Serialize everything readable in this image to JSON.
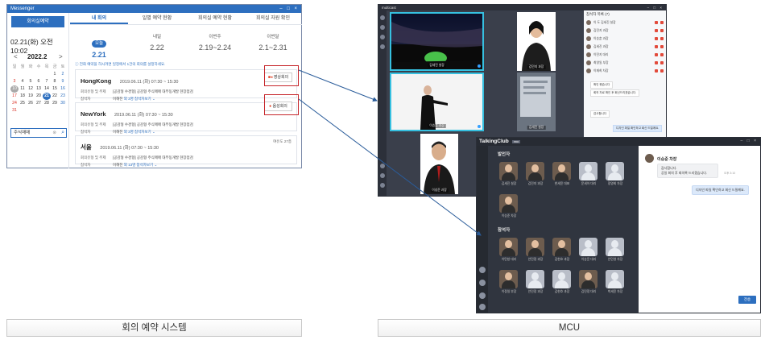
{
  "messenger": {
    "title": "Messenger",
    "reserve_button": "회의실예약",
    "today": "02.21(화) 오전 10:02",
    "calendar": {
      "year_month": "2022.2",
      "prev": "<",
      "next": ">",
      "weekdays": [
        "일",
        "월",
        "화",
        "수",
        "목",
        "금",
        "토"
      ],
      "days": [
        "",
        "",
        "",
        "",
        "",
        "1",
        "2",
        "3",
        "4",
        "5",
        "6",
        "7",
        "8",
        "9",
        "10",
        "11",
        "12",
        "13",
        "14",
        "15",
        "16",
        "17",
        "18",
        "19",
        "20",
        "21",
        "22",
        "23",
        "24",
        "25",
        "26",
        "27",
        "28",
        "29",
        "30",
        "31"
      ]
    },
    "search_value": "주식매매",
    "tabs": [
      "내 회의",
      "일별 예약 현황",
      "회의실 예약 현황",
      "회의실 자원 확인"
    ],
    "periods": [
      {
        "label": "오늘",
        "range": "2.21"
      },
      {
        "label": "내일",
        "range": "2.22"
      },
      {
        "label": "이번주",
        "range": "2.19~2.24"
      },
      {
        "label": "이번달",
        "range": "2.1~2.31"
      }
    ],
    "notice": "ⓘ 전화 예약을 하시려면 일정에서 1건의 회의를 설정하세요.",
    "meetings": [
      {
        "city": "HongKong",
        "time": "2019.06.11 (화) 07:30 ~ 15:30",
        "row1_key": "회의유형 및 주제",
        "row1_val": "[공감형 수경형] 공감형 주식매매 대부동개발 현장점검",
        "row2_key": "참석자",
        "row2_val": "이해진",
        "count": "외 3명",
        "more": "참석자보기 ⌄",
        "remain": ""
      },
      {
        "city": "NewYork",
        "time": "2019.06.11 (화) 07:30 ~ 15:30",
        "row1_key": "회의유형 및 주제",
        "row1_val": "[공감형 수경형] 공감형 주식매매 대부동개발 현장점검",
        "row2_key": "참석자",
        "row2_val": "이해진",
        "count": "외 3명",
        "more": "참석자보기 ⌄",
        "remain": ""
      },
      {
        "city": "서울",
        "time": "2019.06.11 (화) 07:30 ~ 15:30",
        "row1_key": "회의유형 및 주제",
        "row1_val": "[공감형 수경형] 공감형 주식매매 대부동개발 현장점검",
        "row2_key": "참석자",
        "row2_val": "이해진",
        "count": "외 13명",
        "more": "참석자보기 ⌄",
        "remain": "여유도 27층"
      }
    ],
    "video_button": "영상회의",
    "audio_button": "음성회의"
  },
  "captions": {
    "left": "회의 예약 시스템",
    "right": "MCU"
  },
  "mcu": {
    "title": "multicast",
    "tiles": [
      {
        "name": "김세진 설장"
      },
      {
        "name": "김민지 과장"
      },
      {
        "name": "이승훈 과장"
      },
      {
        "name": "김세진 설장"
      },
      {
        "name": "이성준 과장"
      }
    ],
    "participants_header": "참석자 목록 (7)",
    "participants": [
      "이 도 김세진 설장",
      "김민지 과장",
      "이승훈 과장",
      "김세진 과장",
      "이민지 대리",
      "최영일 부장",
      "이재희 차장"
    ],
    "chat": [
      {
        "text": "확인 했습니다",
        "me": false
      },
      {
        "text": "회의 자료 확인 후 회신드리겠습니다.",
        "me": false
      },
      {
        "text": "감사합니다",
        "me": false
      },
      {
        "text": "디자인 파일 확인하고 회신 드릴께요.",
        "me": true
      }
    ]
  },
  "talkingclub": {
    "title": "TalkingClub",
    "badge": "PRO",
    "section_speakers": "발언자",
    "section_attendees": "참석자",
    "speakers": [
      "김세진 설장",
      "김민지 과장",
      "한세윤 대표",
      "문세아 대리",
      "정영회 차장",
      "이승준 차장"
    ],
    "attendees": [
      "이탄창 대리",
      "안민정 과장",
      "김현호 과장",
      "이승윤 대리",
      "안민영 차장",
      "이정일 부장",
      "안민정 과장",
      "김현호 과장",
      "김민정 대리",
      "박세윤 차장"
    ],
    "chat_sender": "이승준 차장",
    "chat_in_1": "감사합니다.",
    "chat_in_2": "공일 회의 후 회의록 드리겠습니다.",
    "chat_in_time": "오후 3:10",
    "chat_out": "디자인 파일 확인하고 회신 드릴께요.",
    "send_button": "전송"
  },
  "colors": {
    "accent": "#2d6fbf",
    "highlight_border": "#c6262b",
    "arrow": "#2a5c9a",
    "mcu_bg": "#3a3f4b"
  }
}
